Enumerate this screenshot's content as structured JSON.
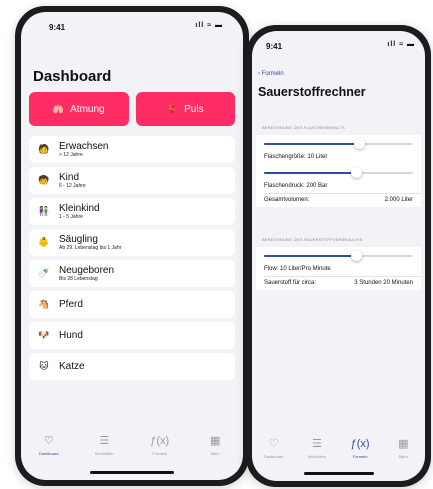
{
  "phone1": {
    "time": "9:41",
    "signal": "ıll ≈ ▬",
    "title": "Dashboard",
    "buttons": [
      {
        "label": "Atmung",
        "icon": "lungs-icon",
        "glyph": "🫁",
        "color": "#ff2d65"
      },
      {
        "label": "Puls",
        "icon": "heart-icon",
        "glyph": "🫀",
        "color": "#ff2d65"
      }
    ],
    "items": [
      {
        "label": "Erwachsen",
        "sub": "> 12 Jahre",
        "glyph": "🧑"
      },
      {
        "label": "Kind",
        "sub": "6 - 12 Jahre",
        "glyph": "🧒"
      },
      {
        "label": "Kleinkind",
        "sub": "1 - 5 Jahre",
        "glyph": "👫"
      },
      {
        "label": "Säugling",
        "sub": "Ab 29. Lebenstag bis 1 Jahr",
        "glyph": "👶"
      },
      {
        "label": "Neugeboren",
        "sub": "Bis 28 Lebenstag",
        "glyph": "🍼"
      },
      {
        "label": "Pferd",
        "sub": "",
        "glyph": "🐴"
      },
      {
        "label": "Hund",
        "sub": "",
        "glyph": "🐶"
      },
      {
        "label": "Katze",
        "sub": "",
        "glyph": "🐱"
      }
    ],
    "tabs": [
      {
        "label": "Dashboard",
        "icon": "stethoscope-icon",
        "glyph": "♡",
        "active": true
      },
      {
        "label": "Merkhilfen",
        "icon": "list-icon",
        "glyph": "☰",
        "active": false
      },
      {
        "label": "Formeln",
        "icon": "function-icon",
        "glyph": "ƒ(x)",
        "active": false
      },
      {
        "label": "Mehr",
        "icon": "grid-icon",
        "glyph": "▦",
        "active": false
      }
    ]
  },
  "phone2": {
    "time": "9:41",
    "signal": "ıll ≈ ▬",
    "back_label": "Formeln",
    "title": "Sauerstoffrechner",
    "section1": {
      "header": "BERECHNUNG DES FLASCHENINHALTS",
      "slider1_value": 0.64,
      "slider1_label": "Flaschengröße: 10 Liter",
      "slider2_value": 0.62,
      "slider2_label": "Flaschendruck: 200 Bar",
      "total_label": "Gesamtvolumen:",
      "total_value": "2.000 Liter"
    },
    "section2": {
      "header": "BERECHNUNG DES SAUERSTOFFVERBRAUCHS",
      "slider_value": 0.62,
      "flow_label": "Flow: 10 Liter/Pro Minute",
      "duration_label": "Sauerstoff für circa:",
      "duration_value": "3 Stunden 20 Minuten"
    },
    "tabs": [
      {
        "label": "Dashboard",
        "icon": "stethoscope-icon",
        "glyph": "♡",
        "active": false
      },
      {
        "label": "Merkhilfen",
        "icon": "list-icon",
        "glyph": "☰",
        "active": false
      },
      {
        "label": "Formeln",
        "icon": "function-icon",
        "glyph": "ƒ(x)",
        "active": true
      },
      {
        "label": "Mehr",
        "icon": "grid-icon",
        "glyph": "▦",
        "active": false
      }
    ]
  },
  "colors": {
    "accent": "#ff2d65",
    "tint": "#2c4f9e",
    "background": "#f2f2f7"
  }
}
